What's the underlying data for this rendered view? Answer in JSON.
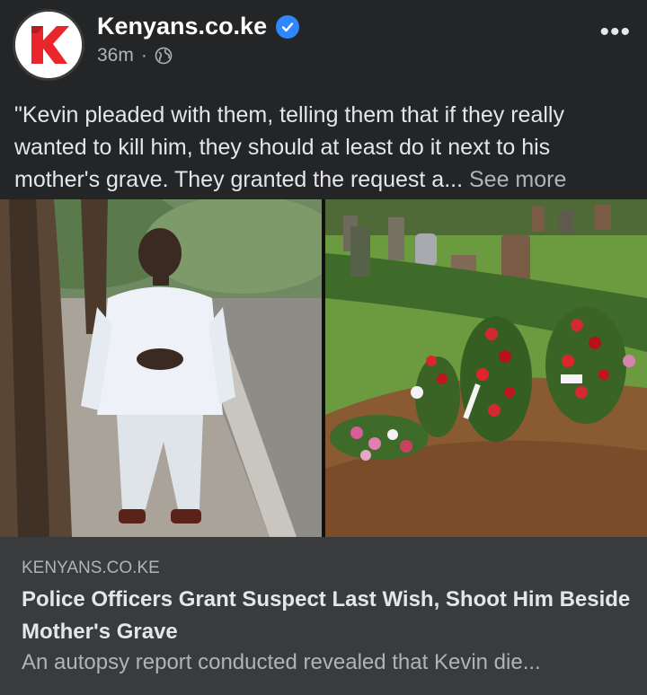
{
  "post": {
    "page_name": "Kenyans.co.ke",
    "time": "36m",
    "separator": "·",
    "privacy_icon": "globe-icon",
    "more_label": "•••",
    "text": "\"Kevin pleaded with them, telling them that if they really wanted to kill him, they should at least do it next to his mother's grave. They granted the request a...",
    "see_more_label": "See more"
  },
  "link": {
    "domain": "KENYANS.CO.KE",
    "title": "Police Officers Grant Suspect Last Wish, Shoot Him Beside Mother's Grave",
    "description": "An autopsy report conducted revealed that Kevin die..."
  },
  "colors": {
    "background": "#242526",
    "card": "#3a3b3c",
    "verified": "#2d88ff",
    "logo_red": "#e8262b"
  }
}
